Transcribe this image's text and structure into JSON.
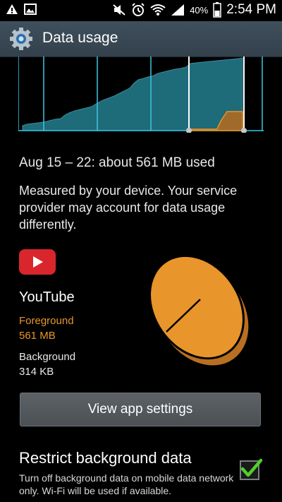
{
  "status_bar": {
    "battery_percent": "40%",
    "time": "2:54 PM",
    "icons": [
      "warning-icon",
      "image-icon",
      "mute-icon",
      "alarm-icon",
      "wifi-icon",
      "signal-icon",
      "battery-icon"
    ]
  },
  "action_bar": {
    "title": "Data usage",
    "icon": "settings-gear-icon"
  },
  "usage_chart": {
    "colors": {
      "total": "#1e6b7a",
      "app": "#e8952c",
      "grid": "#3cc8e6",
      "limit": "#ffffff"
    },
    "selected_range_fraction": [
      0.7,
      0.95
    ]
  },
  "summary": {
    "usage_text": "Aug 15 – 22: about 561 MB used",
    "note": "Measured by your device. Your service provider may account for data usage differently."
  },
  "app": {
    "name": "YouTube",
    "icon": "youtube-icon",
    "foreground_label": "Foreground",
    "foreground_value": "561 MB",
    "background_label": "Background",
    "background_value": "314 KB",
    "colors": {
      "foreground": "#e8952c"
    }
  },
  "buttons": {
    "view_app_settings": "View app settings"
  },
  "restrict": {
    "title": "Restrict background data",
    "description": "Turn off background data on mobile data network only. Wi-Fi will be used if available.",
    "checked": true
  }
}
